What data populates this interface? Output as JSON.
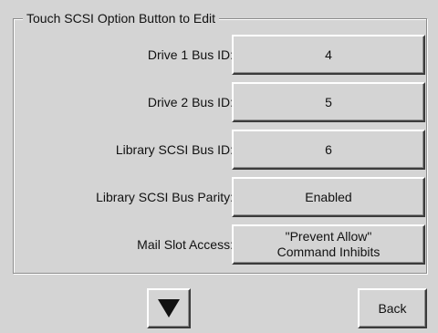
{
  "group": {
    "title": "Touch SCSI Option Button to Edit"
  },
  "rows": [
    {
      "label": "Drive 1 Bus ID:",
      "value": "4"
    },
    {
      "label": "Drive 2 Bus ID:",
      "value": "5"
    },
    {
      "label": "Library SCSI Bus ID:",
      "value": "6"
    },
    {
      "label": "Library SCSI Bus Parity:",
      "value": "Enabled"
    },
    {
      "label": "Mail Slot Access:",
      "value": "\"Prevent Allow\"\nCommand Inhibits"
    }
  ],
  "footer": {
    "down_icon": "down-arrow-icon",
    "back_label": "Back"
  },
  "colors": {
    "background": "#d4d4d4",
    "text": "#111111",
    "frame": "#8c8c8c"
  }
}
